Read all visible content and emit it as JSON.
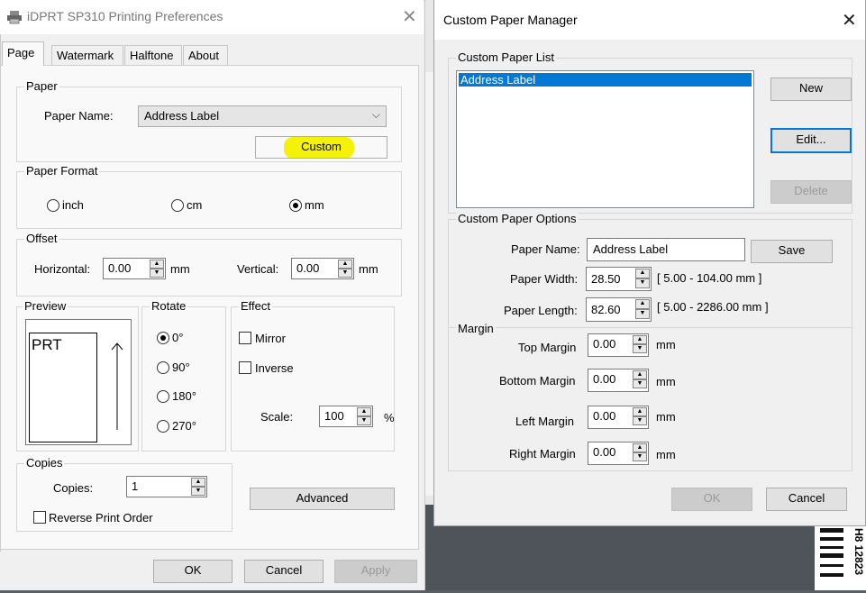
{
  "left_dialog": {
    "title": "iDPRT SP310 Printing Preferences",
    "close": "✕",
    "tabs": [
      "Page",
      "Watermark",
      "Halftone",
      "About"
    ],
    "paper": {
      "group": "Paper",
      "name_label": "Paper Name:",
      "name_value": "Address Label",
      "custom_button": "Custom"
    },
    "paper_format": {
      "group": "Paper Format",
      "options": [
        "inch",
        "cm",
        "mm"
      ],
      "selected": "mm"
    },
    "offset": {
      "group": "Offset",
      "horizontal_label": "Horizontal:",
      "horizontal_value": "0.00",
      "horizontal_unit": "mm",
      "vertical_label": "Vertical:",
      "vertical_value": "0.00",
      "vertical_unit": "mm"
    },
    "preview": {
      "group": "Preview",
      "text": "PRT"
    },
    "rotate": {
      "group": "Rotate",
      "options": [
        "0°",
        "90°",
        "180°",
        "270°"
      ],
      "selected": "0°"
    },
    "effect": {
      "group": "Effect",
      "mirror": "Mirror",
      "inverse": "Inverse",
      "scale_label": "Scale:",
      "scale_value": "100",
      "scale_unit": "%"
    },
    "copies": {
      "group": "Copies",
      "label": "Copies:",
      "value": "1",
      "reverse": "Reverse Print Order"
    },
    "advanced_button": "Advanced",
    "ok": "OK",
    "cancel": "Cancel",
    "apply": "Apply"
  },
  "right_dialog": {
    "title": "Custom Paper Manager",
    "close": "✕",
    "list_group": "Custom Paper List",
    "list_items": [
      "Address Label"
    ],
    "new_button": "New",
    "edit_button": "Edit...",
    "delete_button": "Delete",
    "options_group": "Custom Paper Options",
    "paper_name_label": "Paper Name:",
    "paper_name_value": "Address Label",
    "save_button": "Save",
    "width_label": "Paper Width:",
    "width_value": "28.50",
    "width_range": "[ 5.00 - 104.00 mm ]",
    "length_label": "Paper Length:",
    "length_value": "82.60",
    "length_range": "[ 5.00 - 2286.00 mm ]",
    "margin_group": "Margin",
    "top_label": "Top Margin",
    "top_value": "0.00",
    "bottom_label": "Bottom Margin",
    "bottom_value": "0.00",
    "left_label": "Left Margin",
    "left_value": "0.00",
    "right_label": "Right Margin",
    "right_value": "0.00",
    "unit": "mm",
    "ok": "OK",
    "cancel": "Cancel"
  },
  "background": {
    "barcode_text": "H8 12823"
  }
}
